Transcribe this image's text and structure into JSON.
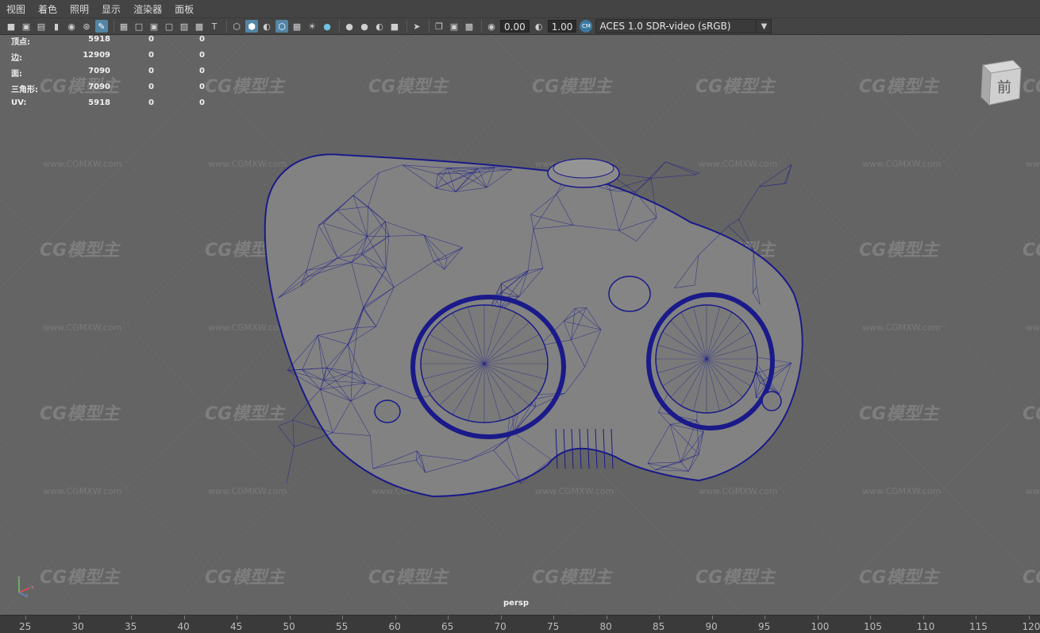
{
  "menu": [
    "视图",
    "着色",
    "照明",
    "显示",
    "渲染器",
    "面板"
  ],
  "toolbar": {
    "field1": "0.00",
    "field2": "1.00",
    "color_management_badge": "CM",
    "color_space": "ACES 1.0 SDR-video (sRGB)",
    "accent_color": "#5285a6"
  },
  "hud": {
    "rows": [
      {
        "label": "顶点:",
        "v1": "5918",
        "v2": "0",
        "v3": "0"
      },
      {
        "label": "边:",
        "v1": "12909",
        "v2": "0",
        "v3": "0"
      },
      {
        "label": "面:",
        "v1": "7090",
        "v2": "0",
        "v3": "0"
      },
      {
        "label": "三角形:",
        "v1": "7090",
        "v2": "0",
        "v3": "0"
      },
      {
        "label": "UV:",
        "v1": "5918",
        "v2": "0",
        "v3": "0"
      }
    ]
  },
  "viewport": {
    "camera": "persp",
    "view_cube_label": "前",
    "wireframe_color": "#1a1a8a",
    "background_color": "#646464",
    "axis_labels": [
      "y",
      "x",
      "z"
    ]
  },
  "watermark": {
    "logo": "CG模型主",
    "url": "www.CGMXW.com"
  },
  "timeline": {
    "ticks": [
      "25",
      "30",
      "35",
      "40",
      "45",
      "50",
      "55",
      "60",
      "65",
      "70",
      "75",
      "80",
      "85",
      "90",
      "95",
      "100",
      "105",
      "110",
      "115",
      "120"
    ]
  }
}
